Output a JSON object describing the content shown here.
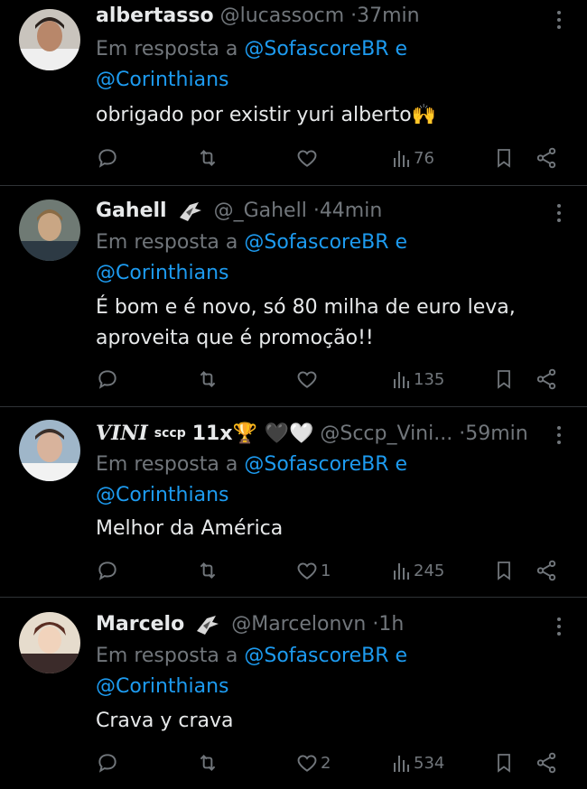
{
  "tweets": [
    {
      "name": "albertasso",
      "name_suffix": "",
      "handle": "@lucassocm",
      "time": "37min",
      "reply_prefix": "Em resposta a",
      "mention1": "@SofascoreBR",
      "conj": "e",
      "mention2": "@Corinthians",
      "text_lines": [
        "obrigado por existir yuri alberto🙌"
      ],
      "reply_count": "",
      "retweet_count": "",
      "like_count": "",
      "views": "76"
    },
    {
      "name": "Gahell",
      "handle": "@_Gahell",
      "time": "44min",
      "reply_prefix": "Em resposta a",
      "mention1": "@SofascoreBR",
      "conj": "e",
      "mention2": "@Corinthians",
      "text_lines": [
        "É bom e é novo, só 80 milha de euro leva,",
        "aproveita que é promoção!!"
      ],
      "reply_count": "",
      "retweet_count": "",
      "like_count": "",
      "views": "135"
    },
    {
      "name": "VINI",
      "name_sup": "sccp",
      "name_after": "11x🏆 🖤🤍",
      "handle": "@Sccp_Vini...",
      "time": "59min",
      "reply_prefix": "Em resposta a",
      "mention1": "@SofascoreBR",
      "conj": "e",
      "mention2": "@Corinthians",
      "text_lines": [
        "Melhor da América"
      ],
      "reply_count": "",
      "retweet_count": "",
      "like_count": "1",
      "views": "245"
    },
    {
      "name": "Marcelo",
      "handle": "@Marcelonvn",
      "time": "1h",
      "reply_prefix": "Em resposta a",
      "mention1": "@SofascoreBR",
      "conj": "e",
      "mention2": "@Corinthians",
      "text_lines": [
        "Crava y crava"
      ],
      "reply_count": "",
      "retweet_count": "",
      "like_count": "2",
      "views": "534"
    }
  ],
  "icons": [
    "reply-icon",
    "retweet-icon",
    "like-icon",
    "views-icon",
    "bookmark-icon",
    "share-icon",
    "more-icon",
    "avatar",
    "corinthians-badge-icon"
  ],
  "colors": {
    "background": "#000000",
    "text": "#e7e9ea",
    "muted": "#71767b",
    "link": "#1d9bf0",
    "divider": "#2f3336"
  }
}
